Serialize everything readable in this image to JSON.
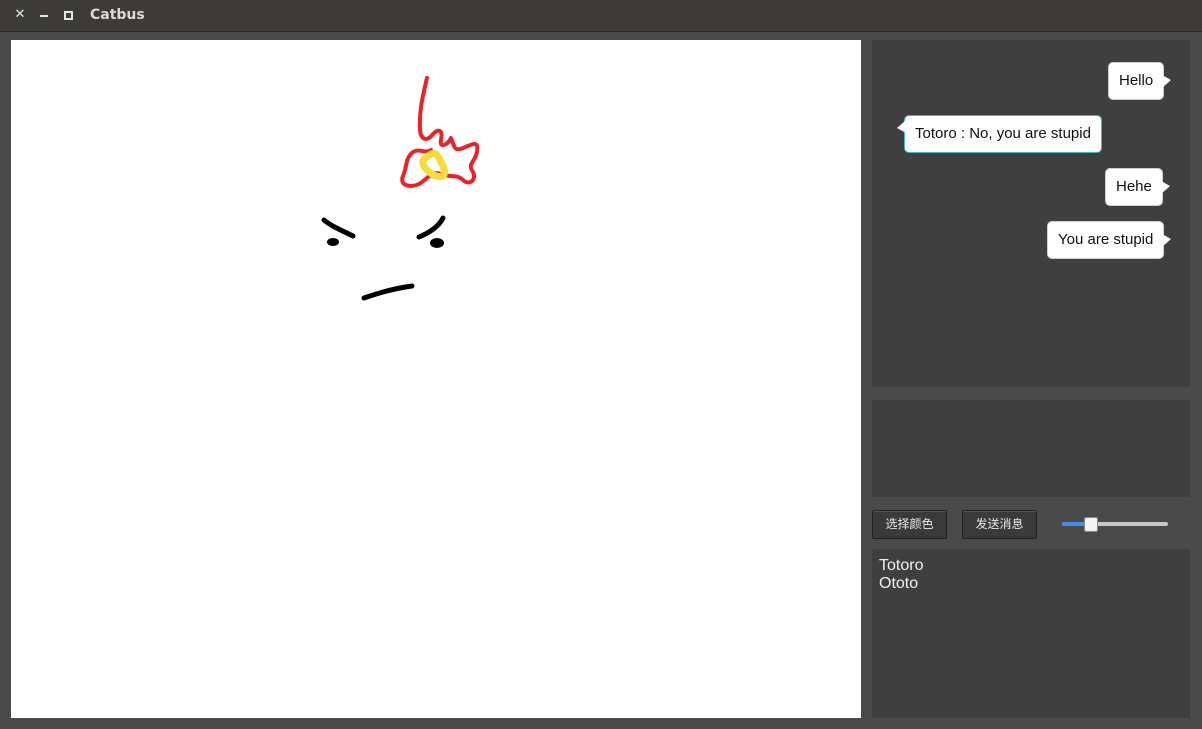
{
  "window": {
    "title": "Catbus"
  },
  "chat": {
    "messages": [
      {
        "text": "Hello",
        "side": "right"
      },
      {
        "text": "Totoro : No, you are stupid",
        "side": "left"
      },
      {
        "text": "Hehe",
        "side": "right"
      },
      {
        "text": "You are stupid",
        "side": "right"
      }
    ]
  },
  "message_input": {
    "value": ""
  },
  "controls": {
    "choose_color_label": "选择颜色",
    "send_message_label": "发送消息",
    "brush_size_fraction": 0.24
  },
  "users": [
    "Totoro",
    "Ototo"
  ],
  "drawing": {
    "stroke_colors": [
      "#e8232b",
      "#f7dd3c",
      "#000000"
    ]
  }
}
